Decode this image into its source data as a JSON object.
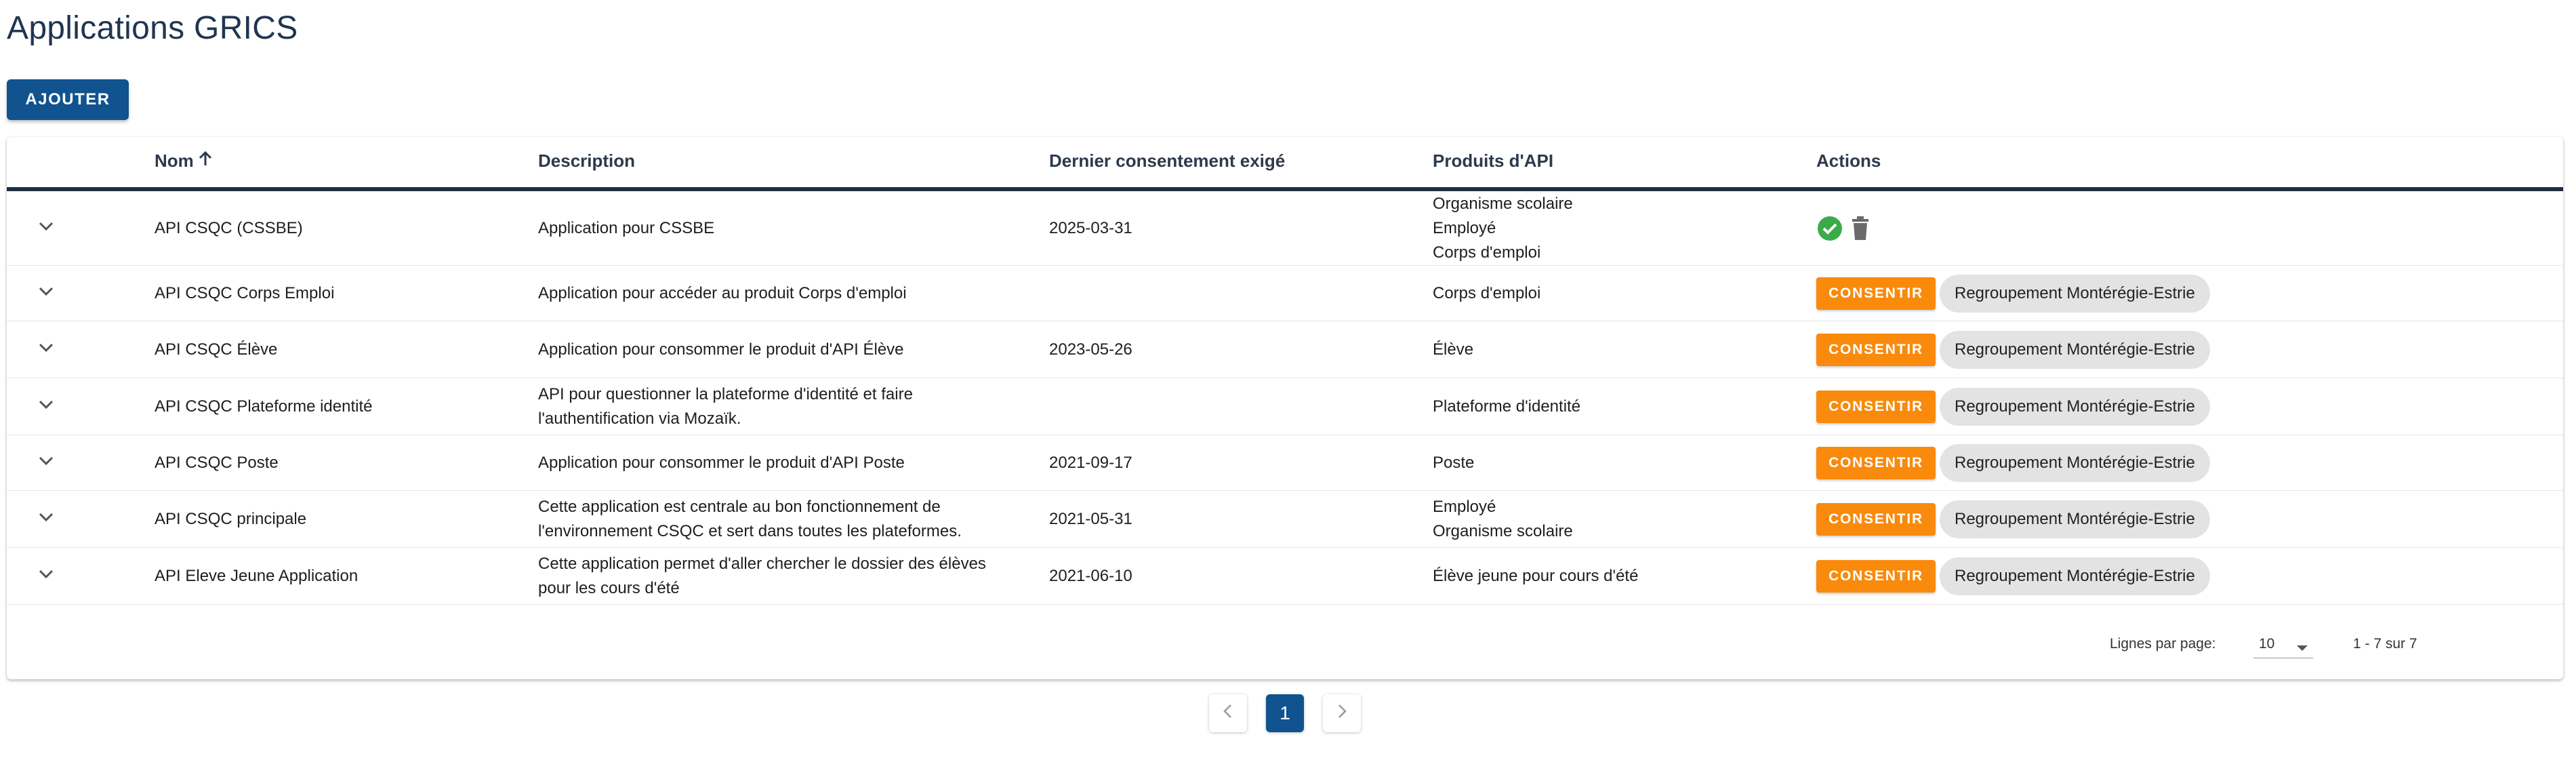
{
  "page": {
    "title": "Applications GRICS"
  },
  "toolbar": {
    "add_label": "AJOUTER"
  },
  "table": {
    "headers": {
      "name": "Nom",
      "description": "Description",
      "consent": "Dernier consentement exigé",
      "products": "Produits d'API",
      "actions": "Actions"
    },
    "sort": {
      "column": "Nom",
      "direction": "ascending",
      "icon": "arrow-up-icon"
    },
    "rows": [
      {
        "name": "API CSQC (CSSBE)",
        "description": [
          "Application pour CSSBE"
        ],
        "consent": "2025-03-31",
        "products": [
          "Organisme scolaire",
          "Employé",
          "Corps d'emploi"
        ],
        "action_type": "icons",
        "status_icon": "check-circle-icon",
        "delete_icon": "trash-icon"
      },
      {
        "name": "API CSQC Corps Emploi",
        "description": [
          "Application pour accéder au produit Corps d'emploi"
        ],
        "consent": "",
        "products": [
          "Corps d'emploi"
        ],
        "action_type": "consent",
        "consent_label": "CONSENTIR",
        "chip_label": "Regroupement Montérégie-Estrie"
      },
      {
        "name": "API CSQC Élève",
        "description": [
          "Application pour consommer le produit d'API Élève"
        ],
        "consent": "2023-05-26",
        "products": [
          "Élève"
        ],
        "action_type": "consent",
        "consent_label": "CONSENTIR",
        "chip_label": "Regroupement Montérégie-Estrie"
      },
      {
        "name": "API CSQC Plateforme identité",
        "description": [
          "API pour questionner la plateforme d'identité et faire",
          "l'authentification via Mozaïk."
        ],
        "consent": "",
        "products": [
          "Plateforme d'identité"
        ],
        "action_type": "consent",
        "consent_label": "CONSENTIR",
        "chip_label": "Regroupement Montérégie-Estrie"
      },
      {
        "name": "API CSQC Poste",
        "description": [
          "Application pour consommer le produit d'API Poste"
        ],
        "consent": "2021-09-17",
        "products": [
          "Poste"
        ],
        "action_type": "consent",
        "consent_label": "CONSENTIR",
        "chip_label": "Regroupement Montérégie-Estrie"
      },
      {
        "name": "API CSQC principale",
        "description": [
          "Cette application est centrale au bon fonctionnement de",
          "l'environnement CSQC et sert dans toutes les plateformes."
        ],
        "consent": "2021-05-31",
        "products": [
          "Employé",
          "Organisme scolaire"
        ],
        "action_type": "consent",
        "consent_label": "CONSENTIR",
        "chip_label": "Regroupement Montérégie-Estrie"
      },
      {
        "name": "API Eleve Jeune Application",
        "description": [
          "Cette application permet d'aller chercher le dossier des élèves",
          "pour les cours d'été"
        ],
        "consent": "2021-06-10",
        "products": [
          "Élève jeune pour cours d'été"
        ],
        "action_type": "consent",
        "consent_label": "CONSENTIR",
        "chip_label": "Regroupement Montérégie-Estrie"
      }
    ],
    "expand_icon": "chevron-down-icon"
  },
  "footer": {
    "rows_per_page_label": "Lignes par page:",
    "rows_per_page_value": "10",
    "range_text": "1 - 7 sur 7"
  },
  "pagination": {
    "current_page": "1",
    "prev_icon": "chevron-left-icon",
    "next_icon": "chevron-right-icon"
  },
  "colors": {
    "primary": "#10538f",
    "consent_button": "#f98a0c",
    "success": "#3bab4a",
    "title": "#1f3550",
    "chip": "#e3e3e3"
  }
}
